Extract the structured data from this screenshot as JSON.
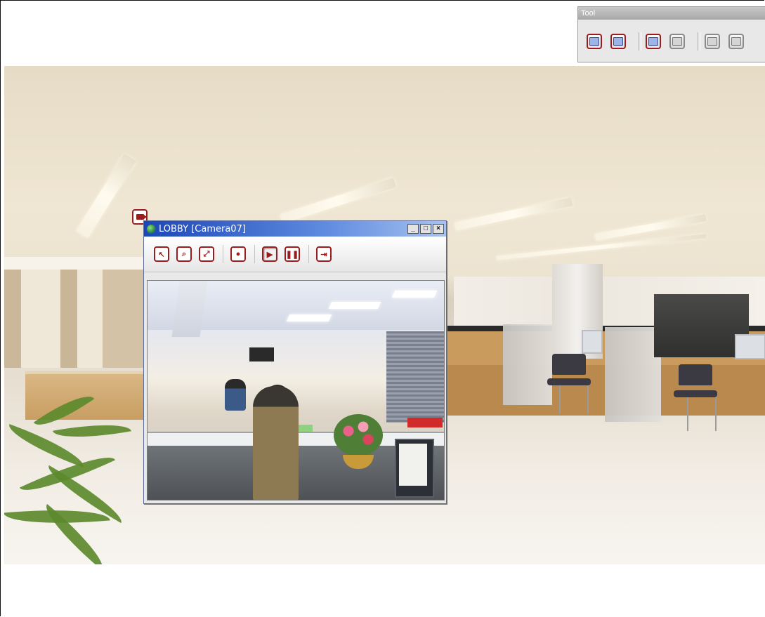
{
  "tool_palette": {
    "title": "Tool",
    "buttons": [
      {
        "icon": "display-icon",
        "style": "active"
      },
      {
        "icon": "edit-icon",
        "style": "active"
      },
      {
        "icon": "map-view-icon",
        "style": "active"
      },
      {
        "icon": "panel-icon",
        "style": "inactive"
      },
      {
        "icon": "copy-icon",
        "style": "inactive"
      },
      {
        "icon": "save-icon",
        "style": "inactive"
      }
    ]
  },
  "camera_window": {
    "title": "LOBBY [Camera07]",
    "window_controls": [
      "_",
      "□",
      "×"
    ],
    "toolbar": [
      {
        "icon": "pointer-icon",
        "symbol": "↖"
      },
      {
        "icon": "zoom-icon",
        "symbol": "⌕"
      },
      {
        "icon": "fit-icon",
        "symbol": "⤢"
      },
      {
        "icon": "record-icon",
        "symbol": "●"
      },
      {
        "icon": "play-icon",
        "symbol": "▶"
      },
      {
        "icon": "pause-icon",
        "symbol": "❚❚"
      },
      {
        "icon": "exit-icon",
        "symbol": "⇥"
      }
    ]
  },
  "camera_marker": {
    "icon": "camera-marker-icon"
  },
  "colors": {
    "accent_red": "#9b1c1c",
    "titlebar_blue": "#1b46b7"
  }
}
